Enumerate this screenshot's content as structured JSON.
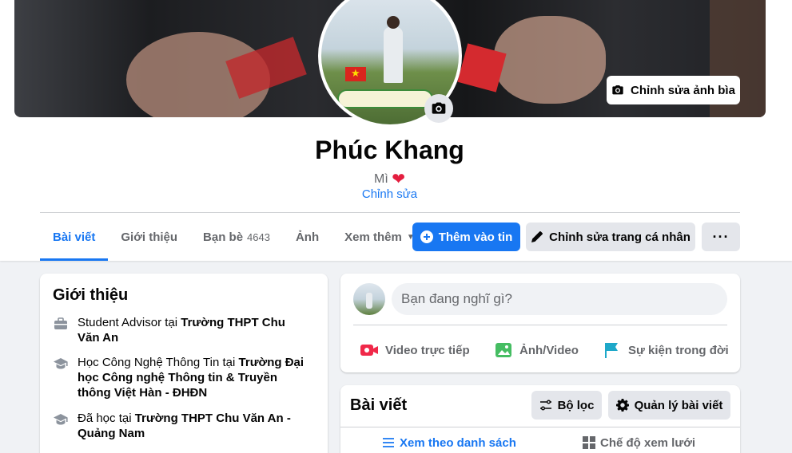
{
  "cover": {
    "edit_label": "Chỉnh sửa ảnh bìa"
  },
  "profile": {
    "name": "Phúc Khang",
    "bio": "Mì",
    "bio_emoji": "❤",
    "edit_bio_label": "Chỉnh sửa"
  },
  "tabs": [
    {
      "label": "Bài viết",
      "active": true
    },
    {
      "label": "Giới thiệu"
    },
    {
      "label": "Bạn bè",
      "count": "4643"
    },
    {
      "label": "Ảnh"
    },
    {
      "label": "Xem thêm"
    }
  ],
  "actions": {
    "add_story": "Thêm vào tin",
    "edit_profile": "Chỉnh sửa trang cá nhân",
    "more": "···"
  },
  "intro": {
    "title": "Giới thiệu",
    "items": [
      {
        "icon": "briefcase-icon",
        "prefix": "Student Advisor tại ",
        "bold": "Trường THPT Chu Văn An",
        "suffix": ""
      },
      {
        "icon": "graduation-cap-icon",
        "prefix": "Học Công Nghệ Thông Tin tại ",
        "bold": "Trường Đại học Công nghệ Thông tin & Truyền thông Việt Hàn - ĐHĐN",
        "suffix": ""
      },
      {
        "icon": "graduation-cap-icon",
        "prefix": "Đã học tại ",
        "bold": "Trường THPT Chu Văn An - Quảng Nam",
        "suffix": ""
      }
    ]
  },
  "composer": {
    "placeholder": "Bạn đang nghĩ gì?",
    "live_video": "Video trực tiếp",
    "photo_video": "Ảnh/Video",
    "life_event": "Sự kiện trong đời"
  },
  "posts": {
    "title": "Bài viết",
    "filter_label": "Bộ lọc",
    "manage_label": "Quản lý bài viết",
    "list_view": "Xem theo danh sách",
    "grid_view": "Chế độ xem lưới"
  },
  "colors": {
    "accent": "#1877f2",
    "live_red": "#f02849",
    "photo_green": "#45bd62",
    "event_teal": "#1ea8c9"
  }
}
